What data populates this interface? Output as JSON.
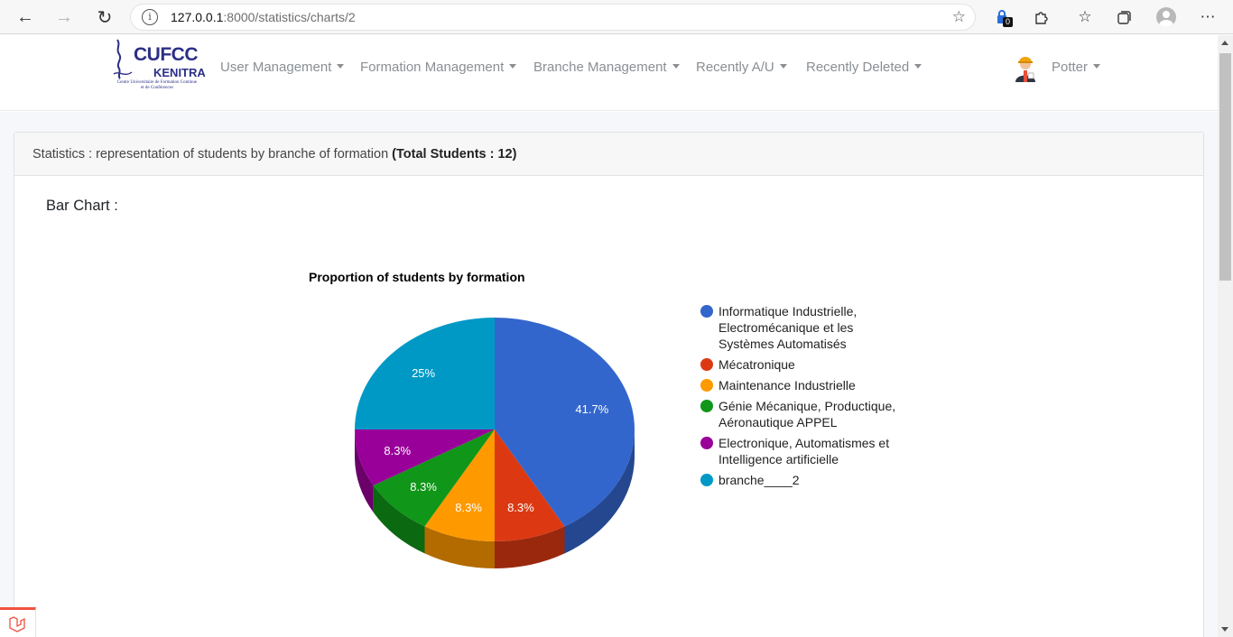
{
  "browser": {
    "url_host": "127.0.0.1",
    "url_rest": ":8000/statistics/charts/2",
    "extension_badge": "0"
  },
  "nav": {
    "logo_title": "CUFCC",
    "logo_city": "KENITRA",
    "logo_sub": "Centre Universitaire de Formation Continue et de Conférences",
    "menu": [
      {
        "label": "User Management"
      },
      {
        "label": "Formation Management"
      },
      {
        "label": "Branche Management"
      },
      {
        "label": "Recently A/U"
      },
      {
        "label": "Recently Deleted"
      }
    ],
    "user": "Potter"
  },
  "card": {
    "header_text": "Statistics : representation of students by branche of formation ",
    "header_total": "(Total Students : 12)",
    "section_title": "Bar Chart :"
  },
  "chart_data": {
    "type": "pie",
    "title": "Proportion of students by formation",
    "labels": [
      "Informatique Industrielle, Electromécanique et les Systèmes Automatisés",
      "Mécatronique",
      "Maintenance Industrielle",
      "Génie Mécanique, Productique, Aéronautique APPEL",
      "Electronique, Automatismes et Intelligence artificielle",
      "branche____2"
    ],
    "legend_lines": [
      [
        "Informatique Industrielle,",
        "Electromécanique et les",
        "Systèmes Automatisés"
      ],
      [
        "Mécatronique"
      ],
      [
        "Maintenance Industrielle"
      ],
      [
        "Génie Mécanique, Productique,",
        "Aéronautique APPEL"
      ],
      [
        "Electronique, Automatismes et",
        "Intelligence artificielle"
      ],
      [
        "branche____2"
      ]
    ],
    "values": [
      5,
      1,
      1,
      1,
      1,
      3
    ],
    "percent_labels": [
      "41.7%",
      "8.3%",
      "8.3%",
      "8.3%",
      "8.3%",
      "25%"
    ],
    "colors": [
      "#3366cc",
      "#dc3912",
      "#ff9900",
      "#109618",
      "#990099",
      "#0099c6"
    ],
    "is3D": true,
    "legend_position": "right"
  }
}
